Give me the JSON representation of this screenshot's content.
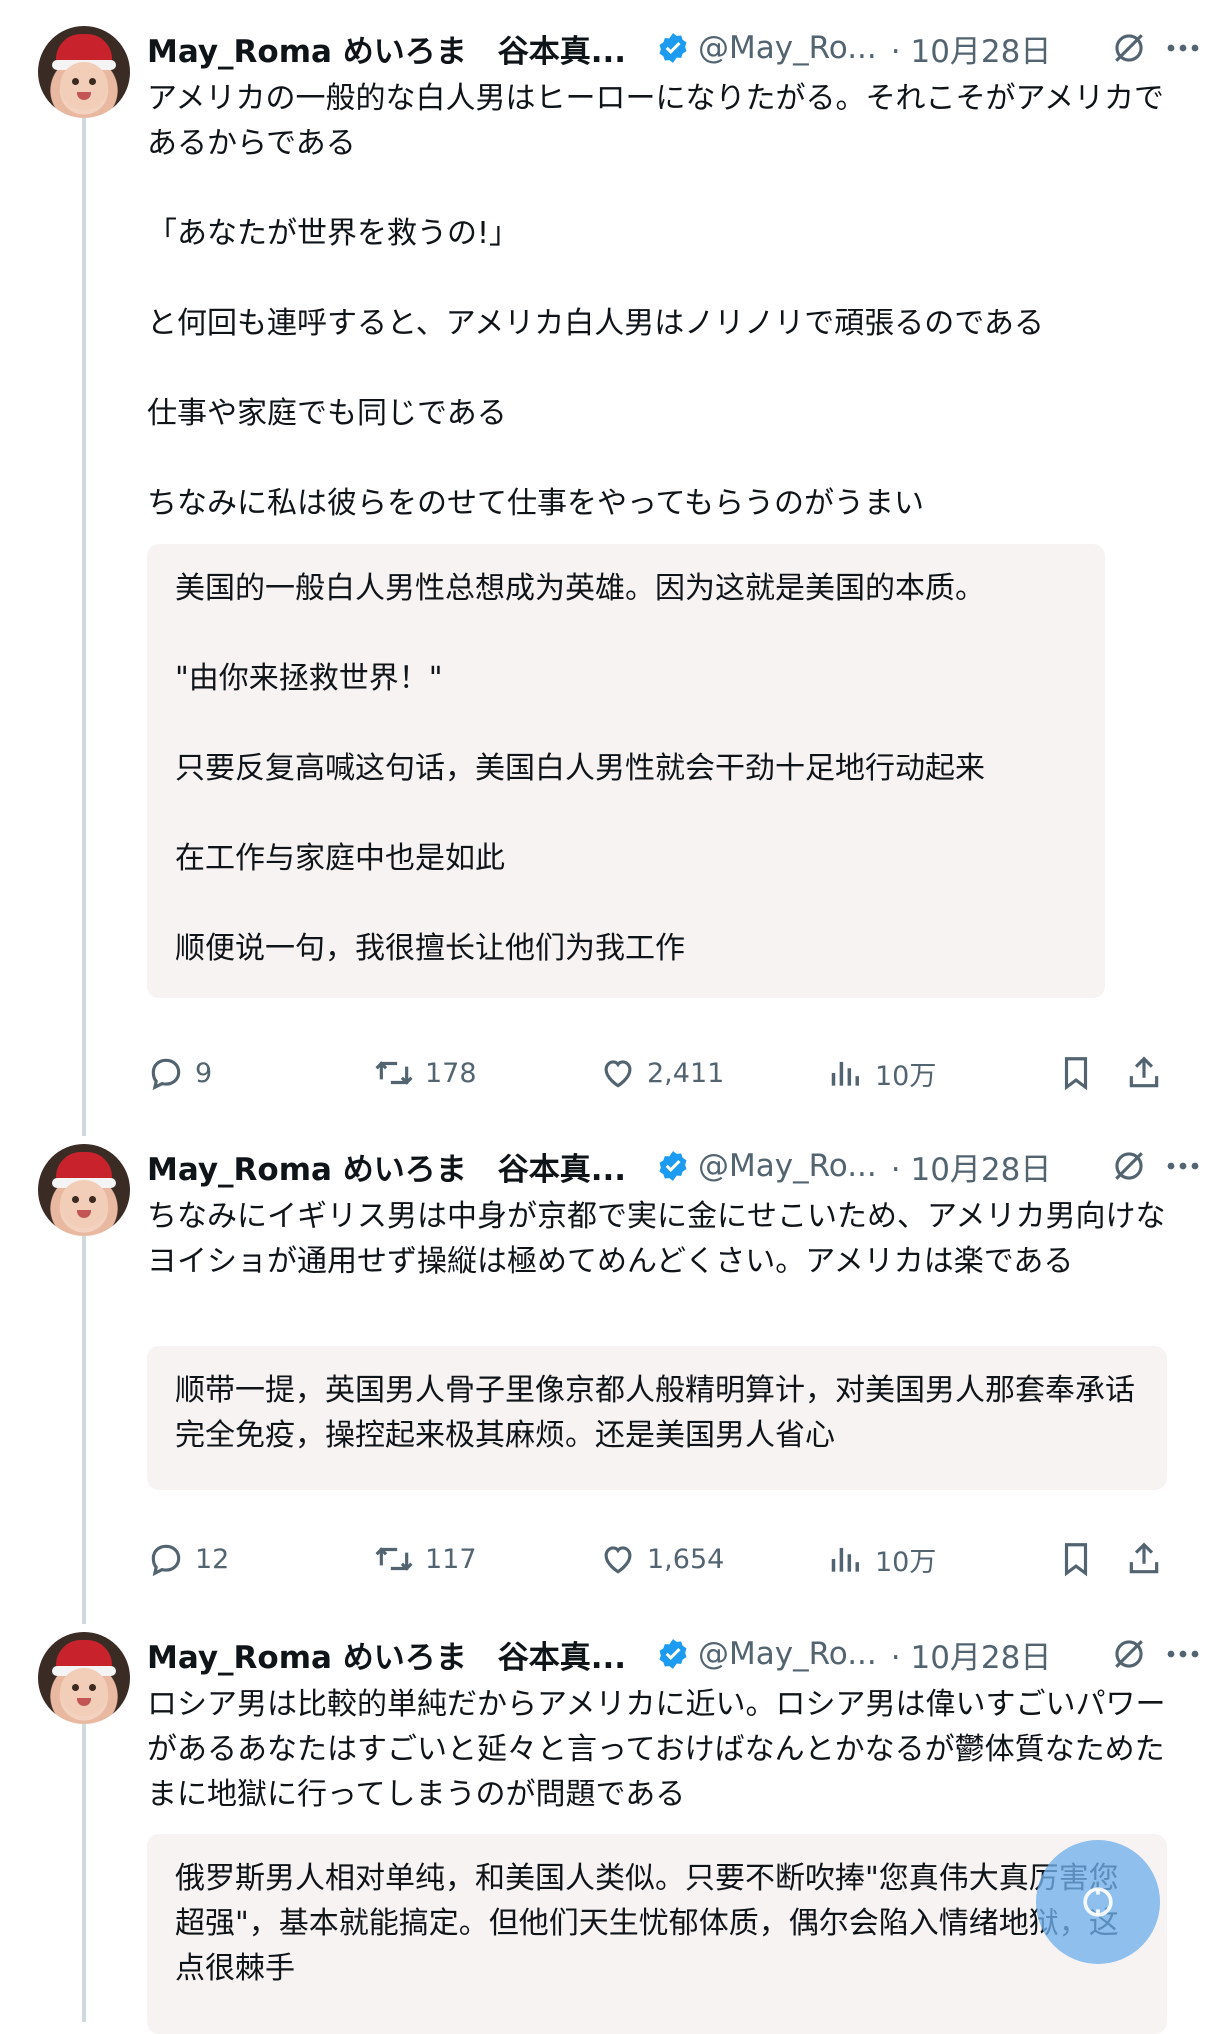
{
  "author": {
    "name": "May_Roma めいろま　谷本真...",
    "handle": "@May_Ro...",
    "verified_color": "#1d9bf0"
  },
  "tweets": [
    {
      "date": "· 10月28日",
      "text": "アメリカの一般的な白人男はヒーローになりたがる。それこそがアメリカであるからである\n\n「あなたが世界を救うの!」\n\nと何回も連呼すると、アメリカ白人男はノリノリで頑張るのである\n\n仕事や家庭でも同じである\n\nちなみに私は彼らをのせて仕事をやってもらうのがうまい",
      "translation": "美国的一般白人男性总想成为英雄。因为这就是美国的本质。\n\n\"由你来拯救世界！\"\n\n只要反复高喊这句话，美国白人男性就会干劲十足地行动起来\n\n在工作与家庭中也是如此\n\n顺便说一句，我很擅长让他们为我工作",
      "replies": "9",
      "reposts": "178",
      "likes": "2,411",
      "views": "10万"
    },
    {
      "date": "· 10月28日",
      "text": "ちなみにイギリス男は中身が京都で実に金にせこいため、アメリカ男向けなヨイショが通用せず操縦は極めてめんどくさい。アメリカは楽である",
      "translation": "顺带一提，英国男人骨子里像京都人般精明算计，对美国男人那套奉承话完全免疫，操控起来极其麻烦。还是美国男人省心",
      "replies": "12",
      "reposts": "117",
      "likes": "1,654",
      "views": "10万"
    },
    {
      "date": "· 10月28日",
      "text": "ロシア男は比較的単純だからアメリカに近い。ロシア男は偉いすごいパワーがあるあなたはすごいと延々と言っておけばなんとかなるが鬱体質なためたまに地獄に行ってしまうのが問題である",
      "translation": "俄罗斯男人相对单纯，和美国人类似。只要不断吹捧\"您真伟大真厉害您超强\"，基本就能搞定。但他们天生忧郁体质，偶尔会陷入情绪地狱，这点很棘手"
    }
  ],
  "icons": {
    "reply": "reply-icon",
    "repost": "repost-icon",
    "like": "heart-icon",
    "views": "views-icon",
    "bookmark": "bookmark-icon",
    "share": "share-icon",
    "more": "more-icon",
    "grok": "grok-icon",
    "fab": "compose-icon"
  }
}
